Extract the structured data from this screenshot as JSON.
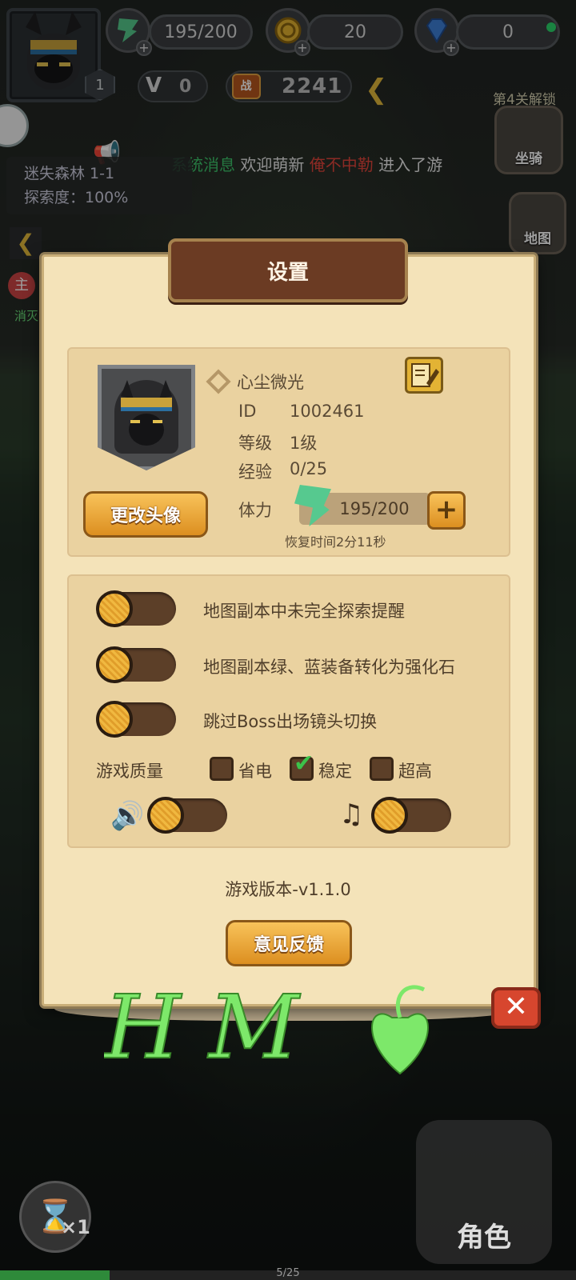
{
  "hud": {
    "level": "1",
    "stamina": "195/200",
    "gold": "20",
    "diamonds": "0",
    "vip": "0",
    "power_badge": "战",
    "power": "2241",
    "unlock_notice": "第4关解锁",
    "mount_label": "坐骑",
    "map_label": "地图"
  },
  "ticker": {
    "tag": "系统消息",
    "text1": "欢迎萌新",
    "name": "俺不中勒",
    "text2": "进入了游"
  },
  "location": {
    "name": "迷失森林 1-1",
    "explore": "探索度：100%"
  },
  "side": {
    "main_badge": "主",
    "message": "消灭"
  },
  "settings": {
    "title": "设置",
    "nickname": "心尘微光",
    "change_avatar": "更改头像",
    "id_label": "ID",
    "id_value": "1002461",
    "level_label": "等级",
    "level_value": "1级",
    "exp_label": "经验",
    "exp_value": "0/25",
    "stamina_label": "体力",
    "stamina_value": "195/200",
    "recover": "恢复时间2分11秒",
    "toggles": [
      {
        "label": "地图副本中未完全探索提醒",
        "on": false
      },
      {
        "label": "地图副本绿、蓝装备转化为强化石",
        "on": false
      },
      {
        "label": "跳过Boss出场镜头切换",
        "on": false
      }
    ],
    "quality_label": "游戏质量",
    "quality_options": [
      "省电",
      "稳定",
      "超高"
    ],
    "quality_selected": "稳定",
    "sound_on": false,
    "music_on": false,
    "version": "游戏版本-v1.1.0",
    "feedback": "意见反馈"
  },
  "bottom": {
    "role": "角色",
    "speed": "×1",
    "page": "5/25",
    "progress": 0.19
  },
  "colors": {
    "panel": "#f4e3b9",
    "title_bar": "#6b3b23",
    "gold_button": "#f0a93a",
    "close": "#d7462e",
    "green_msg": "#3cc26a",
    "red_msg": "#e0443a",
    "watermark": "#7de86a"
  }
}
